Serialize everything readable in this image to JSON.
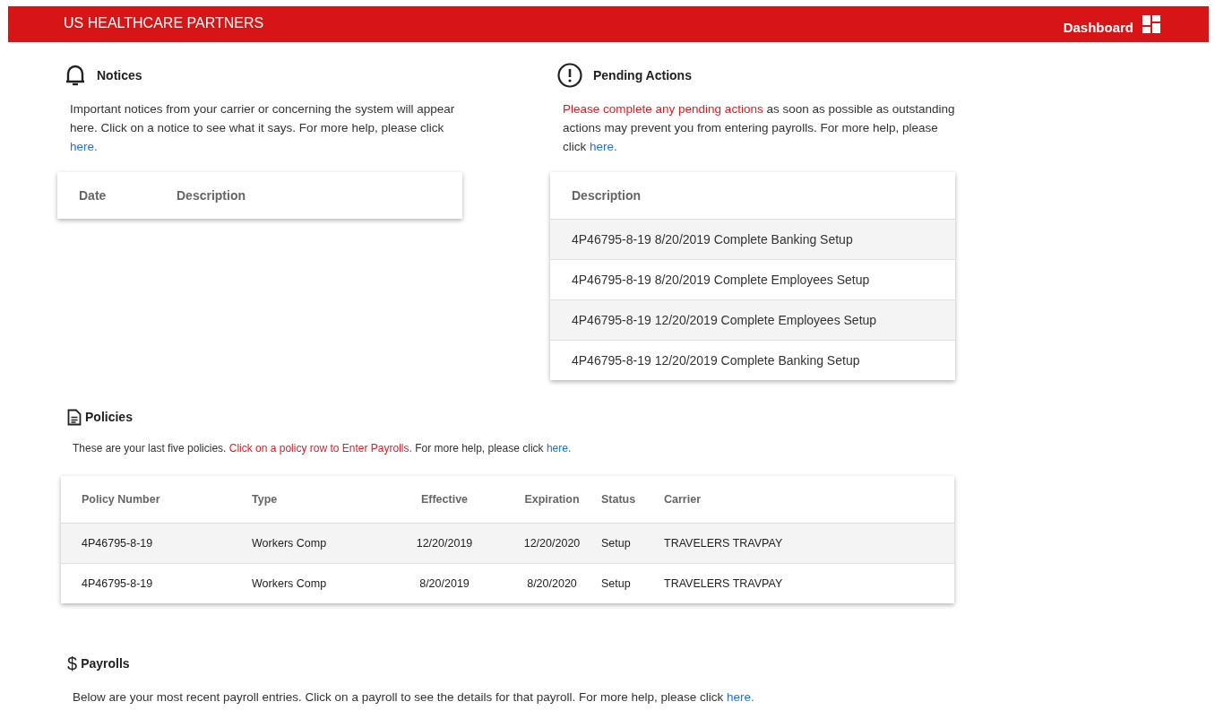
{
  "header": {
    "title": "US HEALTHCARE PARTNERS",
    "nav_label": "Dashboard"
  },
  "notices": {
    "title": "Notices",
    "paragraph": [
      {
        "kind": "plain",
        "text": "Important notices from your carrier or concerning the system will appear here.  Click on a notice to see what it says. For more help, please click "
      },
      {
        "kind": "link",
        "text": "here."
      }
    ],
    "table": {
      "columns": [
        "Date",
        "Description"
      ]
    }
  },
  "pending_actions": {
    "title": "Pending Actions",
    "paragraph": [
      {
        "kind": "alert",
        "text": "Please complete any pending actions"
      },
      {
        "kind": "plain",
        "text": " as soon as possible as outstanding actions may prevent you from entering payrolls. For more help, please click "
      },
      {
        "kind": "link",
        "text": "here."
      }
    ],
    "table": {
      "columns": [
        "Description"
      ],
      "rows": [
        [
          "4P46795-8-19 8/20/2019 Complete Banking Setup"
        ],
        [
          "4P46795-8-19 8/20/2019 Complete Employees Setup"
        ],
        [
          "4P46795-8-19 12/20/2019 Complete Employees Setup"
        ],
        [
          "4P46795-8-19 12/20/2019 Complete Banking Setup"
        ]
      ]
    }
  },
  "policies": {
    "title": "Policies",
    "paragraph": [
      {
        "kind": "plain",
        "text": "These are your last five policies. "
      },
      {
        "kind": "alert",
        "text": "Click on a policy row to Enter Payrolls."
      },
      {
        "kind": "plain",
        "text": " For more help, please click "
      },
      {
        "kind": "link",
        "text": "here."
      }
    ],
    "table": {
      "columns": [
        "Policy Number",
        "Type",
        "Effective",
        "Expiration",
        "Status",
        "Carrier"
      ],
      "rows": [
        [
          "4P46795-8-19",
          "Workers Comp",
          "12/20/2019",
          "12/20/2020",
          "Setup",
          "TRAVELERS TRAVPAY"
        ],
        [
          "4P46795-8-19",
          "Workers Comp",
          "8/20/2019",
          "8/20/2020",
          "Setup",
          "TRAVELERS TRAVPAY"
        ]
      ]
    }
  },
  "payrolls": {
    "icon": "$",
    "title": "Payrolls",
    "paragraph": [
      {
        "kind": "plain",
        "text": "Below are your most recent payroll entries. Click on a payroll to see the details for that payroll. For more help, please click "
      },
      {
        "kind": "link",
        "text": "here."
      }
    ]
  }
}
